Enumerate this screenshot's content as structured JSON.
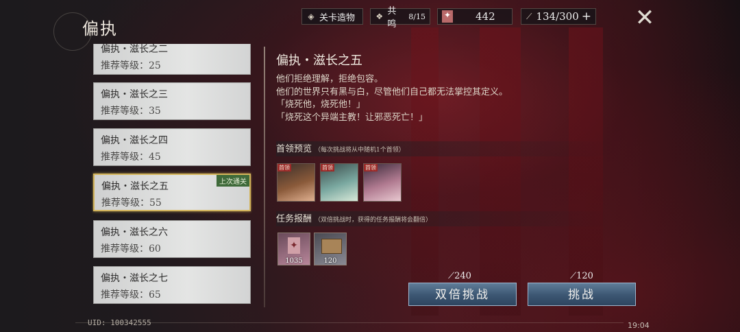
{
  "header": {
    "title": "偏执",
    "relic_button": "关卡造物",
    "resonance_label": "共鸣",
    "resonance_count": "8/15",
    "ticket_count": "442",
    "stamina": "134/300",
    "stamina_add": "+"
  },
  "stages": [
    {
      "name": "偏执・滋长之二",
      "level": "推荐等级：25"
    },
    {
      "name": "偏执・滋长之三",
      "level": "推荐等级：35"
    },
    {
      "name": "偏执・滋长之四",
      "level": "推荐等级：45"
    },
    {
      "name": "偏执・滋长之五",
      "level": "推荐等级：55",
      "badge": "上次通关"
    },
    {
      "name": "偏执・滋长之六",
      "level": "推荐等级：60"
    },
    {
      "name": "偏执・滋长之七",
      "level": "推荐等级：65"
    }
  ],
  "detail": {
    "title": "偏执・滋长之五",
    "description": [
      "他们拒绝理解，拒绝包容。",
      "他们的世界只有黑与白，尽管他们自己都无法掌控其定义。",
      "「烧死他，烧死他！」",
      "「烧死这个异端主教！让邪恶死亡！」"
    ],
    "boss_section": "首领预览",
    "boss_note": "（每次挑战将从中随机1个首领）",
    "boss_tag": "首领",
    "reward_section": "任务报酬",
    "reward_note": "（双倍挑战时，获得的任务报酬将会翻倍）",
    "rewards": [
      {
        "icon": "ticket-icon",
        "count": "1035"
      },
      {
        "icon": "book-icon",
        "count": "120"
      }
    ]
  },
  "actions": {
    "double_cost": "240",
    "double_label": "双倍挑战",
    "challenge_cost": "120",
    "challenge_label": "挑战"
  },
  "footer": {
    "uid": "UID: 100342555",
    "time": "19:04"
  }
}
